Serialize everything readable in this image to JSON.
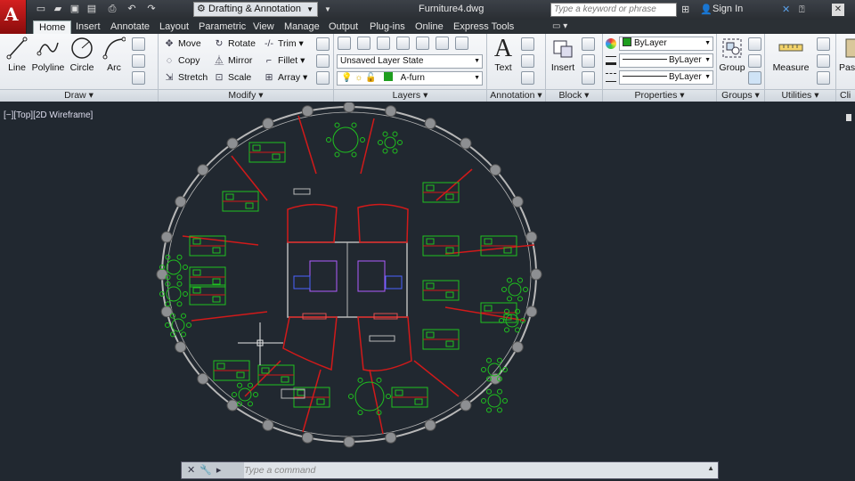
{
  "titlebar": {
    "logo": "A",
    "workspace": "Drafting & Annotation",
    "doc_title": "Furniture4.dwg",
    "search_placeholder": "Type a keyword or phrase",
    "sign_in": "Sign In"
  },
  "tabs": [
    "Home",
    "Insert",
    "Annotate",
    "Layout",
    "Parametric",
    "View",
    "Manage",
    "Output",
    "Plug-ins",
    "Online",
    "Express Tools"
  ],
  "ribbon": {
    "draw": {
      "title": "Draw",
      "tools": [
        "Line",
        "Polyline",
        "Circle",
        "Arc"
      ]
    },
    "modify": {
      "title": "Modify",
      "tools": [
        "Move",
        "Rotate",
        "Trim",
        "Copy",
        "Mirror",
        "Fillet",
        "Stretch",
        "Scale",
        "Array"
      ]
    },
    "layers": {
      "title": "Layers",
      "layer_state": "Unsaved Layer State",
      "current_layer": "A-furn"
    },
    "annotation": {
      "title": "Annotation",
      "text": "Text"
    },
    "block": {
      "title": "Block",
      "insert": "Insert"
    },
    "properties": {
      "title": "Properties",
      "color": "ByLayer",
      "linetype": "ByLayer",
      "lineweight": "ByLayer"
    },
    "groups": {
      "title": "Groups",
      "group": "Group"
    },
    "utilities": {
      "title": "Utilities",
      "measure": "Measure"
    },
    "clipboard": {
      "title": "Cli",
      "paste": "Pas"
    }
  },
  "viewport": {
    "label": "[−][Top][2D Wireframe]"
  },
  "command": {
    "placeholder": "Type a command"
  },
  "colors": {
    "plan_red": "#d11a1a",
    "plan_green": "#1fc21f",
    "plan_grey": "#b8b8b8",
    "layer_green": "#1f9e1f",
    "background": "#212830"
  },
  "icons": [
    "autocad-logo",
    "new-icon",
    "open-icon",
    "save-icon",
    "saveas-icon",
    "plot-icon",
    "undo-icon",
    "redo-icon",
    "search-icon",
    "signin-icon",
    "exchange-icon",
    "help-icon",
    "close-icon"
  ]
}
